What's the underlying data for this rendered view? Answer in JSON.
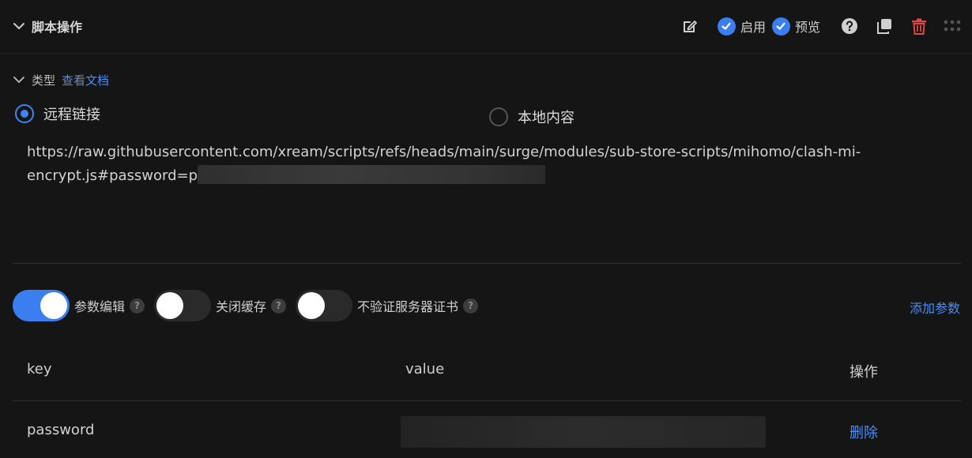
{
  "header": {
    "title": "脚本操作",
    "enable_label": "启用",
    "preview_label": "预览"
  },
  "type_section": {
    "label": "类型",
    "doc_link": "查看文档",
    "options": [
      {
        "label": "远程链接",
        "selected": true
      },
      {
        "label": "本地内容",
        "selected": false
      }
    ],
    "url_text": "https://raw.githubusercontent.com/xream/scripts/refs/heads/main/surge/modules/sub-store-scripts/mihomo/clash-mi-encrypt.js#password=p"
  },
  "switches": [
    {
      "label": "参数编辑",
      "on": true
    },
    {
      "label": "关闭缓存",
      "on": false
    },
    {
      "label": "不验证服务器证书",
      "on": false
    }
  ],
  "add_param_label": "添加参数",
  "table": {
    "headers": {
      "key": "key",
      "value": "value",
      "action": "操作"
    },
    "rows": [
      {
        "key": "password",
        "action": "删除"
      }
    ]
  },
  "colors": {
    "accent": "#3a7ef0",
    "danger": "#e04848",
    "background": "#151515"
  }
}
